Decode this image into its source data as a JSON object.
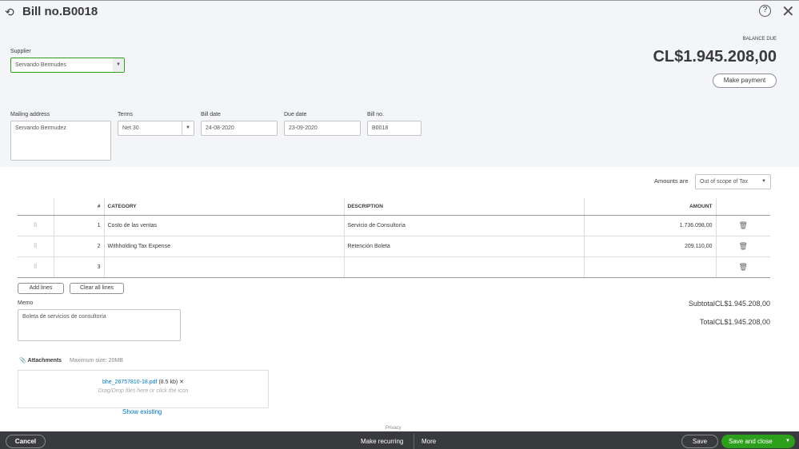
{
  "title": "Bill no.B0018",
  "supplier": {
    "label": "Supplier",
    "value": "Servando Bermudes"
  },
  "balance": {
    "label": "BALANCE DUE",
    "value": "CL$1.945.208,00",
    "make_payment": "Make payment"
  },
  "fields": {
    "mailing_label": "Mailing address",
    "mailing_value": "Servando Bermudez",
    "terms_label": "Terms",
    "terms_value": "Net 30",
    "bill_date_label": "Bill date",
    "bill_date": "24-08-2020",
    "due_date_label": "Due date",
    "due_date": "23-09-2020",
    "bill_no_label": "Bill no.",
    "bill_no": "B0018"
  },
  "amounts_are": {
    "label": "Amounts are",
    "value": "Out of scope of Tax"
  },
  "table": {
    "headers": [
      "#",
      "CATEGORY",
      "DESCRIPTION",
      "AMOUNT"
    ],
    "rows": [
      {
        "n": "1",
        "category": "Costo de las ventas",
        "description": "Servicio de Consultoría",
        "amount": "1.736.098,00"
      },
      {
        "n": "2",
        "category": "Withholding Tax Expense",
        "description": "Retención Boleta",
        "amount": "209.110,00"
      },
      {
        "n": "3",
        "category": "",
        "description": "",
        "amount": ""
      }
    ]
  },
  "add_lines": "Add lines",
  "clear_lines": "Clear all lines",
  "memo": {
    "label": "Memo",
    "value": "Boleta de servicios de consultoría"
  },
  "subtotal": {
    "label": "Subtotal",
    "value": "CL$1.945.208,00"
  },
  "total": {
    "label": "Total",
    "value": "CL$1.945.208,00"
  },
  "attachments": {
    "label": "Attachments",
    "max": "Maximum size: 20MB",
    "file": "bhe_26757810-18.pdf",
    "size": "(8.5 kb)",
    "drop": "Drag/Drop files here or click the icon",
    "show_existing": "Show existing"
  },
  "privacy": "Privacy",
  "footer": {
    "cancel": "Cancel",
    "make_recurring": "Make recurring",
    "more": "More",
    "save": "Save",
    "save_close": "Save and close"
  }
}
